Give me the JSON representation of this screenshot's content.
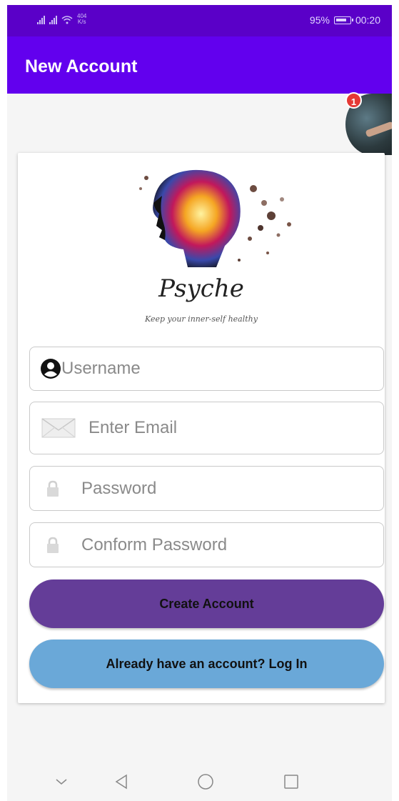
{
  "status_bar": {
    "net_speed_value": "404",
    "net_speed_unit": "K/s",
    "battery": "95%",
    "time": "00:20"
  },
  "app_bar": {
    "title": "New Account"
  },
  "notification": {
    "count": "1"
  },
  "brand": {
    "name": "Psyche",
    "tagline": "Keep your inner-self healthy"
  },
  "form": {
    "username_placeholder": "Username",
    "email_placeholder": "Enter Email",
    "password_placeholder": "Password",
    "confirm_placeholder": "Conform Password"
  },
  "buttons": {
    "create_label": "Create Account",
    "login_label": "Already have an account? Log In"
  },
  "colors": {
    "status_bar": "#5a00c8",
    "app_bar": "#6200ee",
    "create_button": "#643d98",
    "login_button": "#6aa8d8",
    "badge": "#e53935"
  },
  "icons": [
    "signal-icon",
    "wifi-icon",
    "battery-icon",
    "user-icon",
    "mail-icon",
    "lock-icon",
    "back-icon",
    "home-icon",
    "recents-icon",
    "collapse-icon"
  ]
}
